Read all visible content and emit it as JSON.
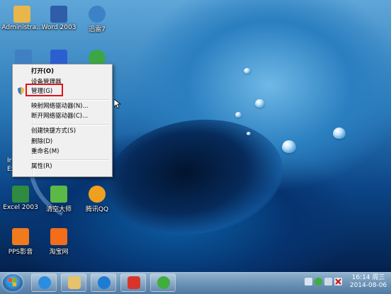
{
  "desktop_icons": [
    {
      "name": "administrator",
      "label": "Administra...",
      "color": "#e8b64a"
    },
    {
      "name": "word-2003",
      "label": "Word 2003",
      "color": "#2f5da8"
    },
    {
      "name": "xunlei",
      "label": "迅雷7",
      "color": "#3c82c8"
    },
    {
      "name": "computer",
      "label": "",
      "color": "#3f7fc4"
    },
    {
      "name": "baidu",
      "label": "",
      "color": "#2b5fd0"
    },
    {
      "name": "360",
      "label": "",
      "color": "#3ca646"
    },
    {
      "name": "excel-2003",
      "label": "Excel 2003",
      "color": "#2e8b3f"
    },
    {
      "name": "qingkong-dashi",
      "label": "清空大师",
      "color": "#5cb847"
    },
    {
      "name": "tencent-qq",
      "label": "腾讯QQ",
      "color": "#f0a020"
    },
    {
      "name": "pps",
      "label": "PPS影音",
      "color": "#f07a1c"
    },
    {
      "name": "taobao",
      "label": "淘宝网",
      "color": "#f36d1a"
    }
  ],
  "edge_labels": [
    "Ir",
    "Ex"
  ],
  "context_menu": {
    "open": "打开(O)",
    "device_manager": "设备管理器",
    "manage": "管理(G)",
    "map_drive": "映射网络驱动器(N)...",
    "disconnect_drive": "断开网络驱动器(C)...",
    "create_shortcut": "创建快捷方式(S)",
    "delete": "删除(D)",
    "rename": "重命名(M)",
    "properties": "属性(R)"
  },
  "taskbar": {
    "apps": [
      {
        "name": "ie",
        "color": "#2a8ee0"
      },
      {
        "name": "explorer",
        "color": "#e6c36a"
      },
      {
        "name": "ie-alt",
        "color": "#1e7bd4"
      },
      {
        "name": "app-red",
        "color": "#d9342b"
      },
      {
        "name": "360-green",
        "color": "#3fae3f"
      }
    ],
    "clock": {
      "time": "16:14 周三",
      "date": "2014-08-06"
    }
  },
  "colors": {
    "highlight": "#e0141e"
  }
}
